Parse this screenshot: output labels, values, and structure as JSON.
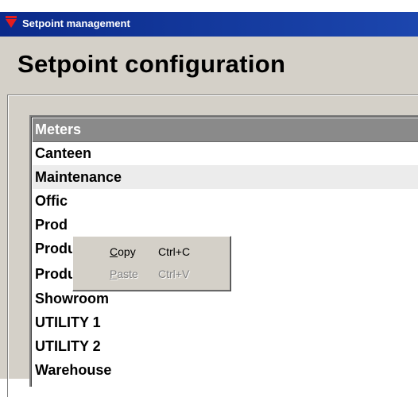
{
  "window": {
    "title": "Setpoint management",
    "accent_color": "#0b2a8a",
    "icon": "red-triangle-logo-icon"
  },
  "page": {
    "heading": "Setpoint configuration"
  },
  "meters_list": {
    "header": "Meters",
    "items": [
      "Canteen",
      "Maintenance",
      "Offic",
      "Prod",
      "Production B",
      "Production C",
      "Showroom",
      "UTILITY 1",
      "UTILITY 2",
      "Warehouse"
    ],
    "hovered_item": "Maintenance"
  },
  "context_menu": {
    "copy": {
      "label_underlined": "C",
      "label_rest": "opy",
      "shortcut": "Ctrl+C",
      "enabled": true
    },
    "paste": {
      "label_underlined": "P",
      "label_rest": "aste",
      "shortcut": "Ctrl+V",
      "enabled": false
    }
  }
}
